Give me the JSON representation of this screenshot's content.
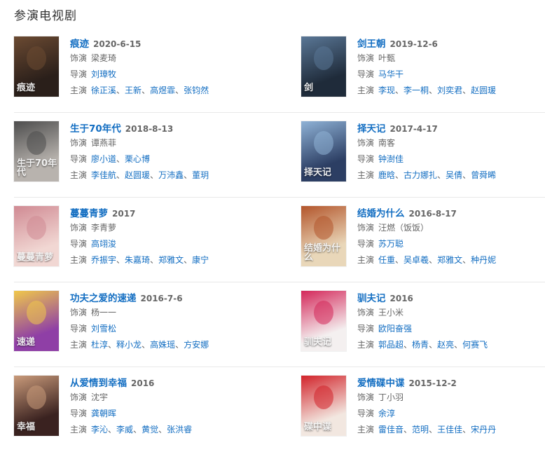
{
  "section": {
    "title": "参演电视剧"
  },
  "labels": {
    "role": "饰演",
    "director": "导演",
    "cast": "主演"
  },
  "separator": "、",
  "dramas": [
    {
      "title": "痕迹",
      "date": "2020-6-15",
      "role": "梁麦琦",
      "directors": [
        "刘璋牧"
      ],
      "cast": [
        "徐正溪",
        "王新",
        "高煜霏",
        "张钧然"
      ],
      "poster": {
        "bg": "#2a1f1a",
        "accent": "#6b4a32",
        "glyph": "痕迹"
      }
    },
    {
      "title": "剑王朝",
      "date": "2019-12-6",
      "role": "叶甄",
      "directors": [
        "马华干"
      ],
      "cast": [
        "李现",
        "李一桐",
        "刘奕君",
        "赵圆瑗"
      ],
      "poster": {
        "bg": "#1f2b3a",
        "accent": "#5a7796",
        "glyph": "剑"
      }
    },
    {
      "title": "生于70年代",
      "date": "2018-8-13",
      "role": "谭燕菲",
      "directors": [
        "廖小道",
        "栗心博"
      ],
      "cast": [
        "李佳航",
        "赵圆瑗",
        "万沛鑫",
        "董玥"
      ],
      "poster": {
        "bg": "#b8b3ae",
        "accent": "#4d4d4d",
        "glyph": "生于70年代"
      }
    },
    {
      "title": "择天记",
      "date": "2017-4-17",
      "role": "南客",
      "directors": [
        "钟澍佳"
      ],
      "cast": [
        "鹿晗",
        "古力娜扎",
        "吴倩",
        "曾舜晞"
      ],
      "poster": {
        "bg": "#2c3e63",
        "accent": "#8fb2d6",
        "glyph": "择天记"
      }
    },
    {
      "title": "蔓蔓青萝",
      "date": "2017",
      "role": "李青萝",
      "directors": [
        "高翊浚"
      ],
      "cast": [
        "乔振宇",
        "朱嘉琦",
        "郑雅文",
        "康宁"
      ],
      "poster": {
        "bg": "#f1d7d3",
        "accent": "#d08a93",
        "glyph": "蔓蔓青萝"
      }
    },
    {
      "title": "结婚为什么",
      "date": "2016-8-17",
      "role": "汪燃（饭饭）",
      "directors": [
        "苏万聪"
      ],
      "cast": [
        "任重",
        "吴卓羲",
        "郑雅文",
        "种丹妮"
      ],
      "poster": {
        "bg": "#e9d7b9",
        "accent": "#b3552b",
        "glyph": "结婚为什么"
      }
    },
    {
      "title": "功夫之爱的速递",
      "date": "2016-7-6",
      "role": "杨一一",
      "directors": [
        "刘雪松"
      ],
      "cast": [
        "杜淳",
        "释小龙",
        "高姝瑶",
        "方安娜"
      ],
      "poster": {
        "bg": "#8f3fa6",
        "accent": "#f0c84a",
        "glyph": "速递"
      }
    },
    {
      "title": "驯夫记",
      "date": "2016",
      "role": "王小米",
      "directors": [
        "欧阳奋强"
      ],
      "cast": [
        "郭品超",
        "杨青",
        "赵亮",
        "何赛飞"
      ],
      "poster": {
        "bg": "#f4f0f0",
        "accent": "#d4285a",
        "glyph": "驯夫记"
      }
    },
    {
      "title": "从爱情到幸福",
      "date": "2016",
      "role": "沈宇",
      "directors": [
        "龚朝晖"
      ],
      "cast": [
        "李沁",
        "李威",
        "黄觉",
        "张洪睿"
      ],
      "poster": {
        "bg": "#3a2220",
        "accent": "#c99a7a",
        "glyph": "幸福"
      }
    },
    {
      "title": "爱情碟中谍",
      "date": "2015-12-2",
      "role": "丁小羽",
      "directors": [
        "余淳"
      ],
      "cast": [
        "雷佳音",
        "范明",
        "王佳佳",
        "宋丹丹"
      ],
      "poster": {
        "bg": "#f2e7e0",
        "accent": "#d2232a",
        "glyph": "碟中谍"
      }
    }
  ]
}
